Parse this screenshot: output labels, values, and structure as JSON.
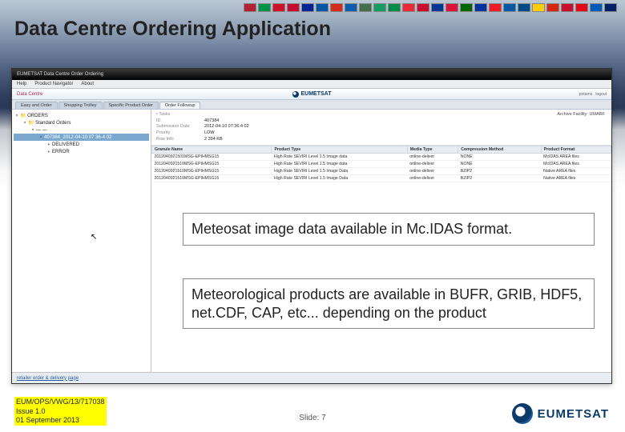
{
  "slide": {
    "title": "Data Centre Ordering Application",
    "caption1": "Meteosat image data available in Mc.IDAS format.",
    "caption2": "Meteorological products are available in BUFR, GRIB, HDF5, net.CDF, CAP, etc... depending on the product",
    "footer_ref": "EUM/OPS/VWG/13/717038",
    "footer_issue": "Issue 1.0",
    "footer_date": "01 September 2013",
    "footer_slide": "Slide: 7",
    "logo_text": "EUMETSAT"
  },
  "flags": [
    "#b22234",
    "#009246",
    "#ce1126",
    "#c60c30",
    "#002395",
    "#0055a4",
    "#d52b1e",
    "#0d5eaf",
    "#436f4d",
    "#169b62",
    "#008c45",
    "#ed2939",
    "#c8102e",
    "#003893",
    "#dc143c",
    "#006600",
    "#0033a0",
    "#ee1c25",
    "#005aa7",
    "#004b87",
    "#ffcd00",
    "#d62612",
    "#c8102e",
    "#e30a17",
    "#005bbb",
    "#012169"
  ],
  "app": {
    "window_title": "EUMETSAT Data Centre Order Ordering",
    "menu": [
      "Help",
      "Product Navigator",
      "About"
    ],
    "brand_left": "Data Centre",
    "brand_center": "EUMETSAT",
    "brand_right_user": "potams",
    "brand_right_logout": "logout",
    "tabs": [
      "Easy and Order",
      "Shopping Trolley",
      "Specific Product Order",
      "Order Followup"
    ],
    "active_tab": 3,
    "tree": {
      "root": "ORDERS",
      "n1": "Standard Orders",
      "n2": "—",
      "n2_sel": "407384_2012-04-10 07 36-4 02",
      "n3a": "DELIVERED",
      "n3b": "ERROR"
    },
    "detail": {
      "section": "Tasks",
      "id_label": "ID",
      "id": "407384",
      "start_label": "Submission Date",
      "start": "2012-04-10 07:36:4 02",
      "priority_label": "Priority",
      "priority": "LOW",
      "row_label": "Row  Info",
      "row_info": "2 394 KB",
      "archive_label": "Archive Facility: UMARF"
    },
    "table": {
      "headers": [
        "Granule Name",
        "Product Type",
        "Media Type",
        "Compression Method",
        "Product Format"
      ],
      "rows": [
        [
          "2012040921501MSG-EPIHMSG15",
          "High Rate SEVIRI Level 1.5 Image data",
          "online-deliver",
          "NONE",
          "McIDAS AREA files"
        ],
        [
          "2012040921510MSG-EPIHMSG15",
          "High Rate SEVIRI Level 1.5 Image data",
          "online-deliver",
          "NONE",
          "McIDAS AREA files"
        ],
        [
          "2012040921510MSG-EPIHMSG15",
          "High Rate SEVIRI Level 1.5 Image Data",
          "online-deliver",
          "BZIP2",
          "Native AREA files"
        ],
        [
          "2012040921510MSG-EPIHMSG15",
          "High Rate SEVIRI Level 1.5 Image Data",
          "online-deliver",
          "BZIP2",
          "Native AREA files"
        ]
      ]
    },
    "status_link": "retailer order & delivery page"
  }
}
